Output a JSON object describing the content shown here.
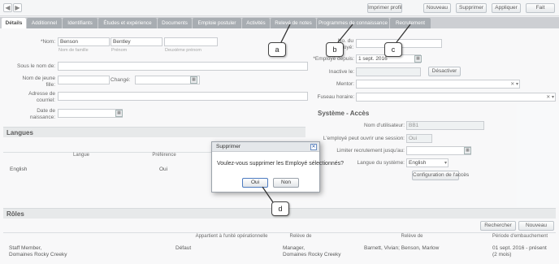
{
  "toolbar": {
    "back_symbol": "◀",
    "forward_symbol": "▶",
    "buttons": [
      "Imprimer profil",
      "Nouveau",
      "Supprimer",
      "Appliquer",
      "Fait"
    ]
  },
  "tabs": [
    "Détails",
    "Additionnel",
    "Identifiants",
    "Études et expérience",
    "Documents",
    "Emploie postuler",
    "Activités",
    "Relevé de notes",
    "Programmes de connaissance",
    "Recrutement"
  ],
  "name": {
    "label": "*Nom:",
    "last_name": "Benson",
    "first_name": "Bentley",
    "middle_name": "",
    "hint_last": "Nom de famille",
    "hint_first": "Prénom",
    "hint_middle": "Deuxième prénom"
  },
  "left_fields": {
    "nickname_label": "Sous le nom de:",
    "maiden_label": "Nom de jeune fille:",
    "changed_label": "Changé:",
    "email_label": "Adresse de courriel:",
    "birth_label": "Date de naissance:",
    "calendar_icon": "▦"
  },
  "right_fields": {
    "employee_number_label": "No. du employé:",
    "employee_since_label": "*Employé depuis:",
    "employee_since_value": "1 sept. 2016",
    "inactive_label": "Inactive le:",
    "deactivate_label": "Désactiver",
    "mentor_label": "Mentor:",
    "timezone_label": "Fuseau horaire:",
    "combo_symbols": "✕ ▾"
  },
  "system_access": {
    "title": "Système - Accès",
    "username_label": "Nom d'utilisateur:",
    "username_value": "BB1",
    "can_open_label": "L'employé peut ouvrir une session:",
    "can_open_value": "Oui",
    "recruit_label": "Limiter recrutement jusqu'au:",
    "language_label": "Langue du système:",
    "language_value": "English",
    "config_button": "Configuration de l'accès"
  },
  "languages": {
    "title": "Langues",
    "headers": [
      "Langue",
      "Préférence"
    ],
    "rows": [
      [
        "English",
        "Oui"
      ]
    ]
  },
  "roles": {
    "title": "Rôles",
    "search_button": "Rechercher",
    "new_button": "Nouveau",
    "headers": [
      "Appartient à l'unité opérationnelle",
      "Relève de",
      "Relève de",
      "Période d'embauchement"
    ],
    "row": {
      "role": "Staff Member,",
      "role_org": "Domaines Rocky Creeky",
      "default": "Défaut",
      "reports_to": "Manager,",
      "reports_org": "Domaines Rocky Creeky",
      "reports_names": "Barnett, Vivian; Benson, Marlow",
      "period": "01 sept. 2016 - présent",
      "duration": "(2 mois)"
    }
  },
  "dialog": {
    "title": "Supprimer",
    "close_symbol": "✕",
    "message": "Voulez-vous supprimer les Employé sélectionnés?",
    "yes_label": "Oui",
    "no_label": "Non"
  },
  "callouts": [
    "a",
    "b",
    "c",
    "d"
  ]
}
